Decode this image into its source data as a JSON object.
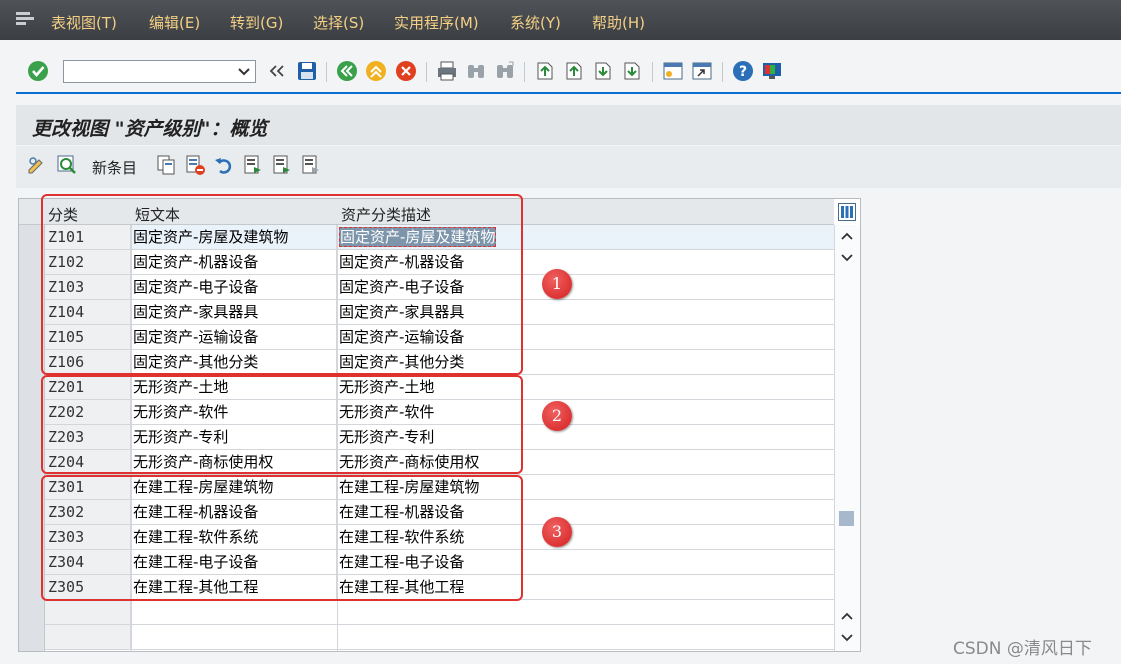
{
  "menu": {
    "items": [
      {
        "label": "表视图(T)"
      },
      {
        "label": "编辑(E)"
      },
      {
        "label": "转到(G)"
      },
      {
        "label": "选择(S)"
      },
      {
        "label": "实用程序(M)"
      },
      {
        "label": "系统(Y)"
      },
      {
        "label": "帮助(H)"
      }
    ]
  },
  "toolbar": {
    "command_value": "",
    "icons": [
      "check-icon",
      "command-dropdown",
      "collapse-icon",
      "save-icon",
      "back-icon",
      "exit-icon",
      "cancel-icon",
      "print-icon",
      "find-icon",
      "find-next-icon",
      "first-page-icon",
      "previous-page-icon",
      "next-page-icon",
      "last-page-icon",
      "create-session-icon",
      "shortcut-icon",
      "help-icon",
      "customize-layout-icon"
    ]
  },
  "title": "更改视图 \"资产级别\"：概览",
  "app_toolbar": {
    "new_entries_label": "新条目"
  },
  "table": {
    "headers": {
      "col1": "分类",
      "col2": "短文本",
      "col3": "资产分类描述"
    },
    "rows": [
      {
        "code": "Z101",
        "short": "固定资产-房屋及建筑物",
        "desc": "固定资产-房屋及建筑物"
      },
      {
        "code": "Z102",
        "short": "固定资产-机器设备",
        "desc": "固定资产-机器设备"
      },
      {
        "code": "Z103",
        "short": "固定资产-电子设备",
        "desc": "固定资产-电子设备"
      },
      {
        "code": "Z104",
        "short": "固定资产-家具器具",
        "desc": "固定资产-家具器具"
      },
      {
        "code": "Z105",
        "short": "固定资产-运输设备",
        "desc": "固定资产-运输设备"
      },
      {
        "code": "Z106",
        "short": "固定资产-其他分类",
        "desc": "固定资产-其他分类"
      },
      {
        "code": "Z201",
        "short": "无形资产-土地",
        "desc": "无形资产-土地"
      },
      {
        "code": "Z202",
        "short": "无形资产-软件",
        "desc": "无形资产-软件"
      },
      {
        "code": "Z203",
        "short": "无形资产-专利",
        "desc": "无形资产-专利"
      },
      {
        "code": "Z204",
        "short": "无形资产-商标使用权",
        "desc": "无形资产-商标使用权"
      },
      {
        "code": "Z301",
        "short": "在建工程-房屋建筑物",
        "desc": "在建工程-房屋建筑物"
      },
      {
        "code": "Z302",
        "short": "在建工程-机器设备",
        "desc": "在建工程-机器设备"
      },
      {
        "code": "Z303",
        "short": "在建工程-软件系统",
        "desc": "在建工程-软件系统"
      },
      {
        "code": "Z304",
        "short": "在建工程-电子设备",
        "desc": "在建工程-电子设备"
      },
      {
        "code": "Z305",
        "short": "在建工程-其他工程",
        "desc": "在建工程-其他工程"
      }
    ]
  },
  "annotations": {
    "badges": [
      "1",
      "2",
      "3"
    ]
  },
  "watermark": "CSDN @清风日下",
  "colors": {
    "menu_text": "#f4cf84",
    "accent": "#0a6ed1",
    "annotation": "#e03131",
    "selection": "#7d95ab"
  }
}
